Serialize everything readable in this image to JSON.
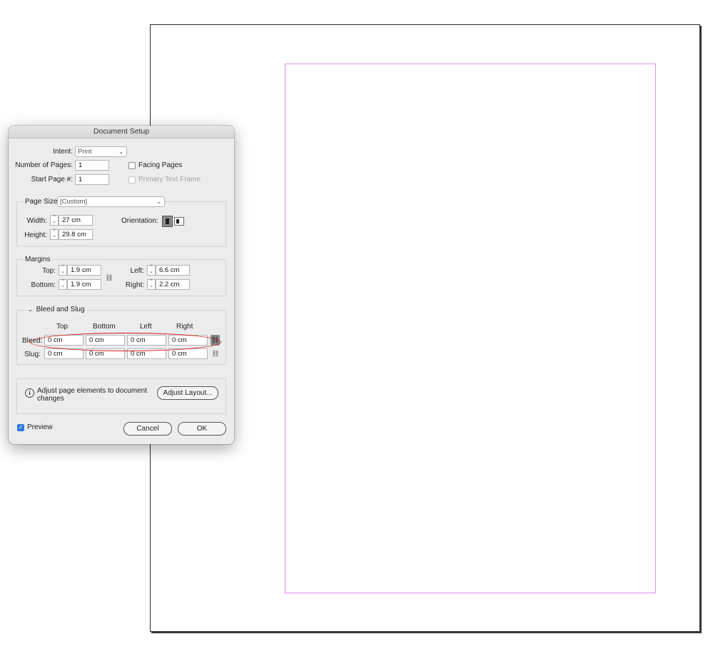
{
  "dialog": {
    "title": "Document Setup",
    "intent_label": "Intent:",
    "intent_value": "Print",
    "pages_label": "Number of Pages:",
    "pages_value": "1",
    "start_label": "Start Page #:",
    "start_value": "1",
    "facing_label": "Facing Pages",
    "primary_label": "Primary Text Frame"
  },
  "page_size": {
    "label": "Page Size:",
    "value": "[Custom]",
    "width_label": "Width:",
    "width_value": "27 cm",
    "height_label": "Height:",
    "height_value": "29.8 cm",
    "orientation_label": "Orientation:"
  },
  "margins": {
    "legend": "Margins",
    "top_label": "Top:",
    "top_value": "1.9 cm",
    "bottom_label": "Bottom:",
    "bottom_value": "1.9 cm",
    "left_label": "Left:",
    "left_value": "6.6 cm",
    "right_label": "Right:",
    "right_value": "2.2 cm"
  },
  "bleed_slug": {
    "legend": "Bleed and Slug",
    "col_top": "Top",
    "col_bottom": "Bottom",
    "col_left": "Left",
    "col_right": "Right",
    "bleed_label": "Bleed:",
    "bleed_values": [
      "0 cm",
      "0 cm",
      "0 cm",
      "0 cm"
    ],
    "slug_label": "Slug:",
    "slug_values": [
      "0 cm",
      "0 cm",
      "0 cm",
      "0 cm"
    ]
  },
  "adjust": {
    "message": "Adjust page elements to document changes",
    "button": "Adjust Layout..."
  },
  "footer": {
    "preview_label": "Preview",
    "cancel": "Cancel",
    "ok": "OK"
  },
  "colors": {
    "margin_guide": "#e28be6",
    "highlight_oval": "#d01818",
    "checkbox_accent": "#2a7bde"
  },
  "icons": {
    "intent_dropdown": "chevron-down-icon",
    "pagesize_dropdown": "chevron-down-icon",
    "portrait": "portrait-orientation-icon",
    "landscape": "landscape-orientation-icon",
    "margins_link": "chain-link-broken-icon",
    "bleed_link": "chain-link-icon",
    "slug_link": "chain-link-broken-icon",
    "info": "info-icon",
    "disclosure": "chevron-down-icon"
  }
}
